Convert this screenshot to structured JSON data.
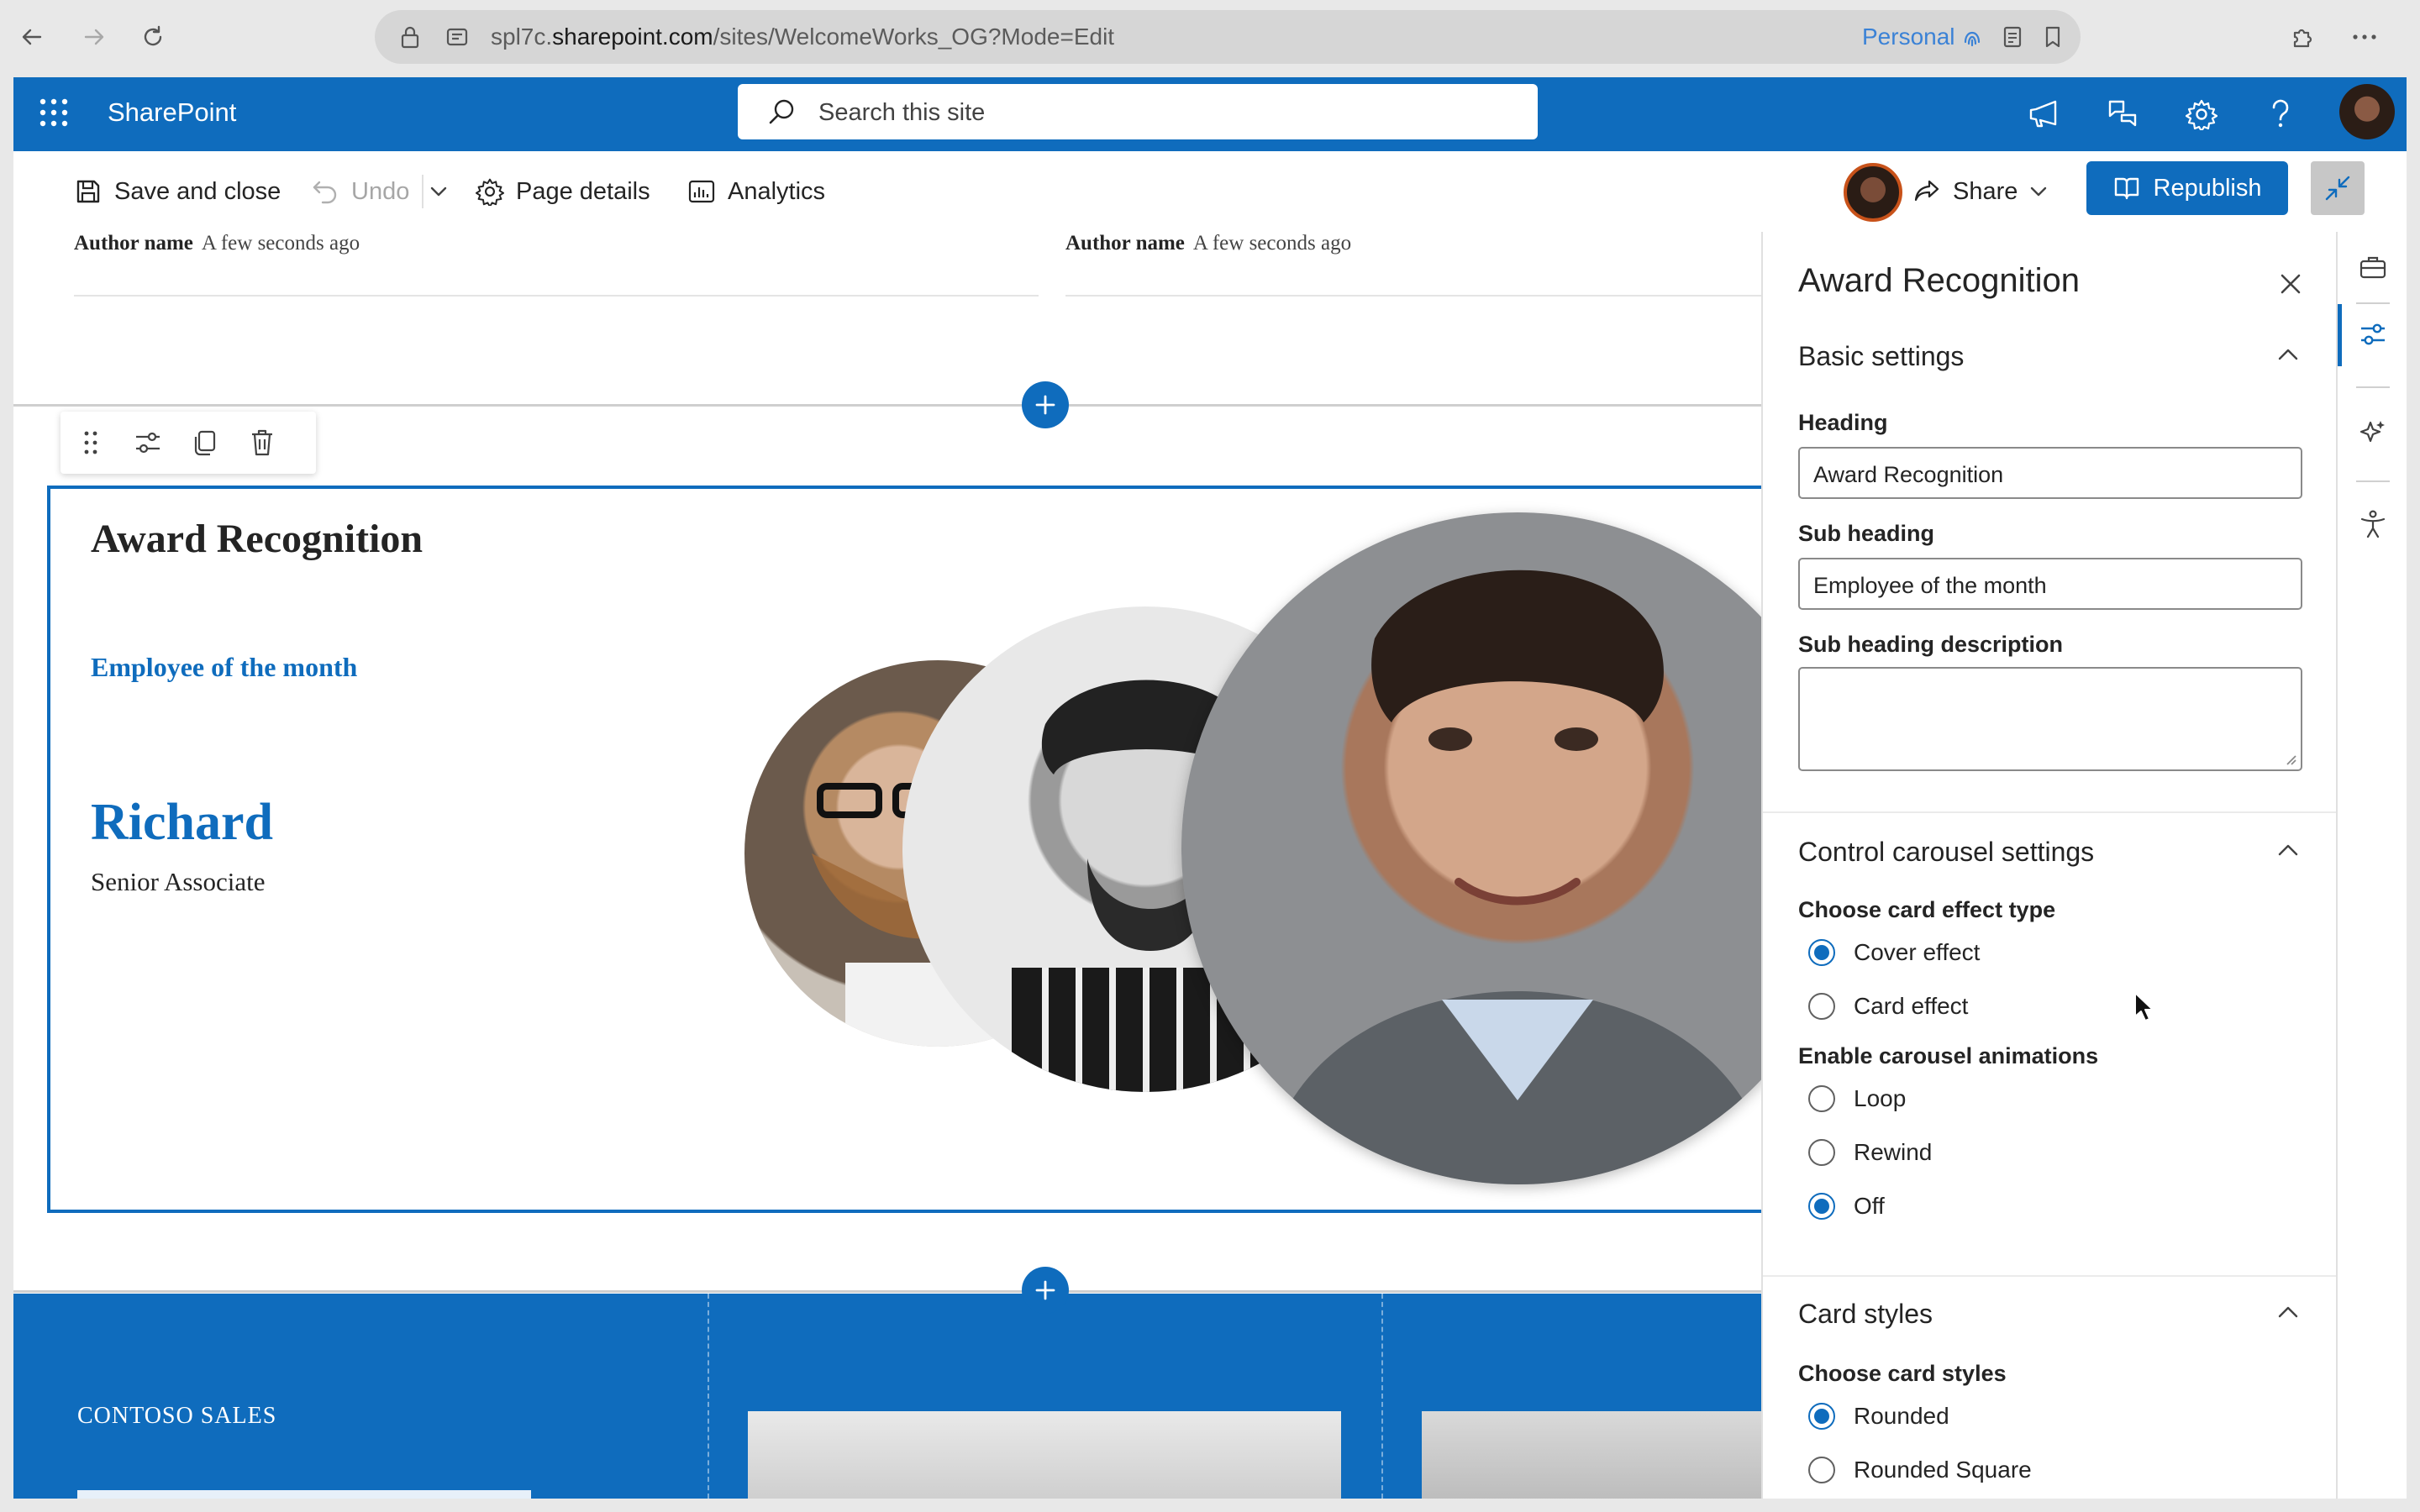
{
  "browser": {
    "url_prefix": "spl7c.",
    "url_host": "sharepoint.com",
    "url_path": "/sites/WelcomeWorks_OG?Mode=Edit",
    "profile_label": "Personal"
  },
  "suitebar": {
    "app_name": "SharePoint",
    "search_placeholder": "Search this site"
  },
  "commandbar": {
    "save_close": "Save and close",
    "undo": "Undo",
    "page_details": "Page details",
    "analytics": "Analytics",
    "share": "Share",
    "republish": "Republish"
  },
  "news": [
    {
      "author": "Author name",
      "time": "A few seconds ago"
    },
    {
      "author": "Author name",
      "time": "A few seconds ago"
    }
  ],
  "webpart": {
    "heading": "Award Recognition",
    "subheading": "Employee of the month",
    "employee_name": "Richard",
    "employee_role": "Senior Associate"
  },
  "band": {
    "label": "CONTOSO SALES"
  },
  "pane": {
    "title": "Award Recognition",
    "basic_settings": "Basic settings",
    "heading_label": "Heading",
    "heading_value": "Award Recognition",
    "subheading_label": "Sub heading",
    "subheading_value": "Employee of the month",
    "subdesc_label": "Sub heading description",
    "subdesc_value": "",
    "carousel_settings": "Control carousel settings",
    "effect_label": "Choose card effect type",
    "effect_options": [
      "Cover effect",
      "Card effect"
    ],
    "effect_selected": "Cover effect",
    "animation_label": "Enable carousel animations",
    "animation_options": [
      "Loop",
      "Rewind",
      "Off"
    ],
    "animation_selected": "Off",
    "card_styles": "Card styles",
    "styles_label": "Choose card styles",
    "style_options": [
      "Rounded",
      "Rounded Square"
    ],
    "style_selected": "Rounded"
  },
  "colors": {
    "brand_blue": "#0f6cbd",
    "accent_orange": "#c8521a"
  }
}
